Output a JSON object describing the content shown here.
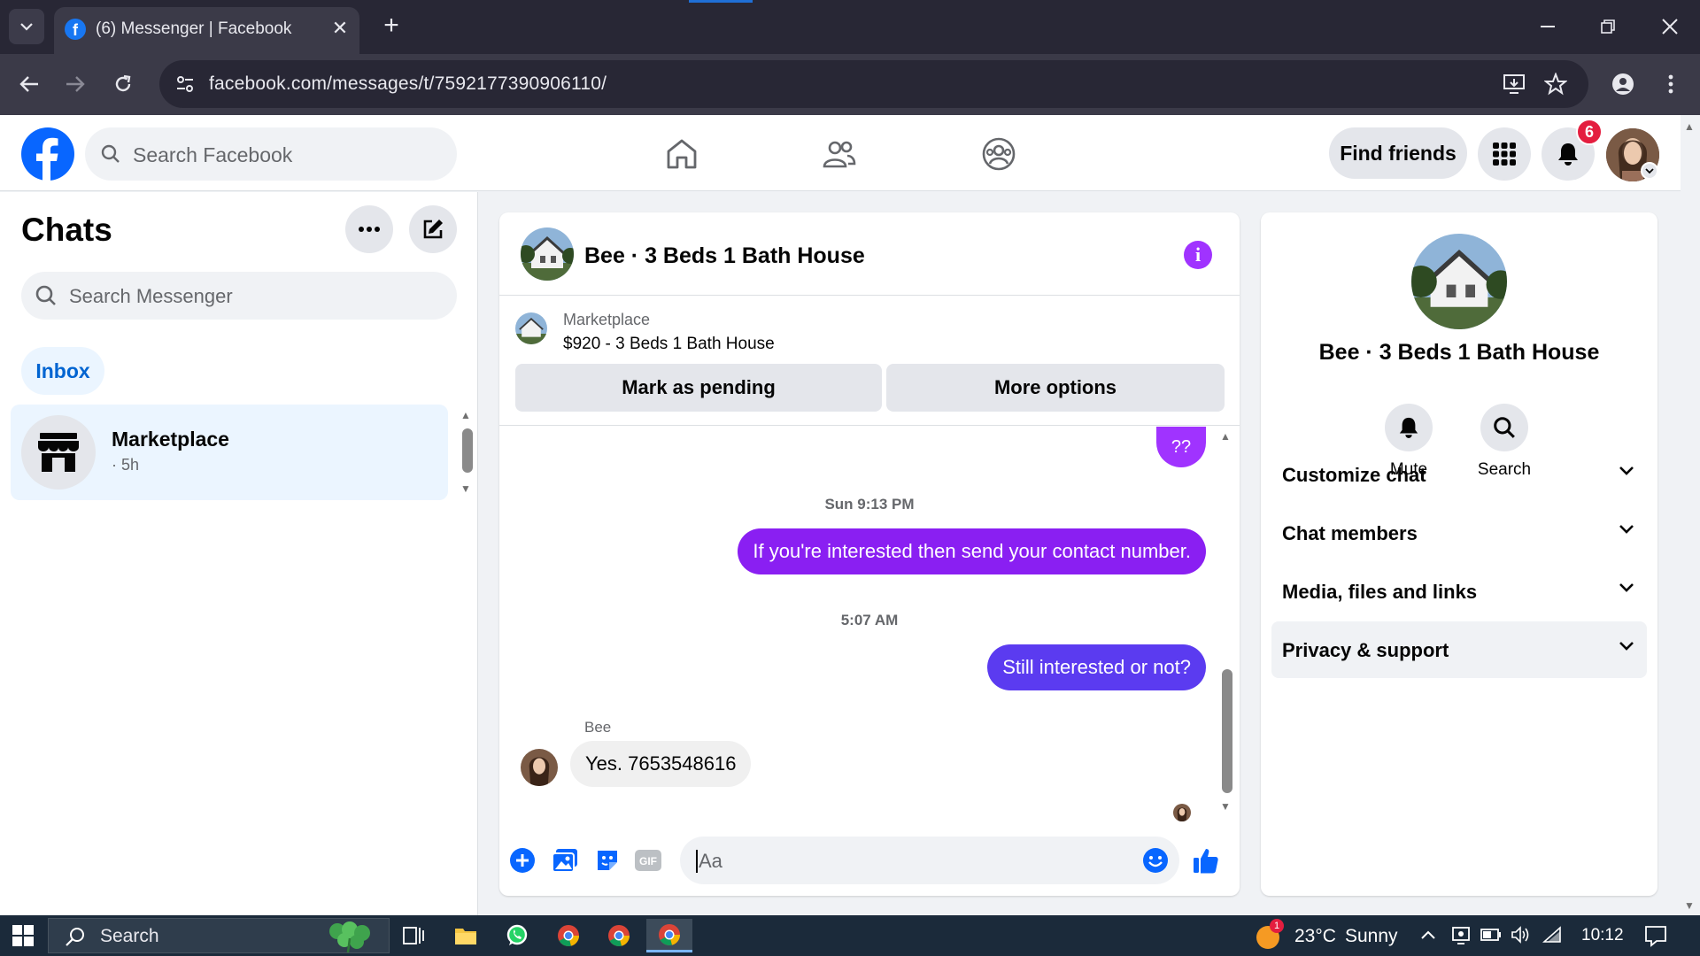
{
  "browser": {
    "tab_title": "(6) Messenger | Facebook",
    "url": "facebook.com/messages/t/7592177390906110/"
  },
  "header": {
    "search_placeholder": "Search Facebook",
    "find_friends_label": "Find friends",
    "notification_count": "6",
    "brand_color": "#1877f2"
  },
  "sidebar": {
    "title": "Chats",
    "search_placeholder": "Search Messenger",
    "filter_label": "Inbox",
    "chats": [
      {
        "name": "Marketplace",
        "time": "· 5h",
        "icon": "store-icon"
      }
    ]
  },
  "conversation": {
    "title": "Bee · 3 Beds 1 Bath House",
    "listing": {
      "source": "Marketplace",
      "title": "$920 - 3 Beds 1 Bath House",
      "mark_pending_label": "Mark as pending",
      "more_options_label": "More options"
    },
    "messages": [
      {
        "type": "outgoing",
        "text": "??"
      },
      {
        "type": "timestamp",
        "text": "Sun 9:13 PM"
      },
      {
        "type": "outgoing",
        "text": "If you're interested then send your contact number."
      },
      {
        "type": "timestamp",
        "text": "5:07 AM"
      },
      {
        "type": "outgoing",
        "text": "Still interested or not?"
      },
      {
        "type": "incoming",
        "sender": "Bee",
        "text": "Yes. 7653548616"
      }
    ],
    "composer_placeholder": "Aa",
    "outgoing_color": "#8a1ff2",
    "accent_color": "#a033ff"
  },
  "info_panel": {
    "name": "Bee · 3 Beds 1 Bath House",
    "actions": [
      {
        "label": "Mute",
        "icon": "bell-icon"
      },
      {
        "label": "Search",
        "icon": "search-icon"
      }
    ],
    "sections": [
      {
        "label": "Customize chat"
      },
      {
        "label": "Chat members"
      },
      {
        "label": "Media, files and links"
      },
      {
        "label": "Privacy & support"
      }
    ]
  },
  "taskbar": {
    "search_label": "Search",
    "weather_temp": "23°C",
    "weather_desc": "Sunny",
    "weather_badge": "1",
    "clock": "10:12"
  }
}
